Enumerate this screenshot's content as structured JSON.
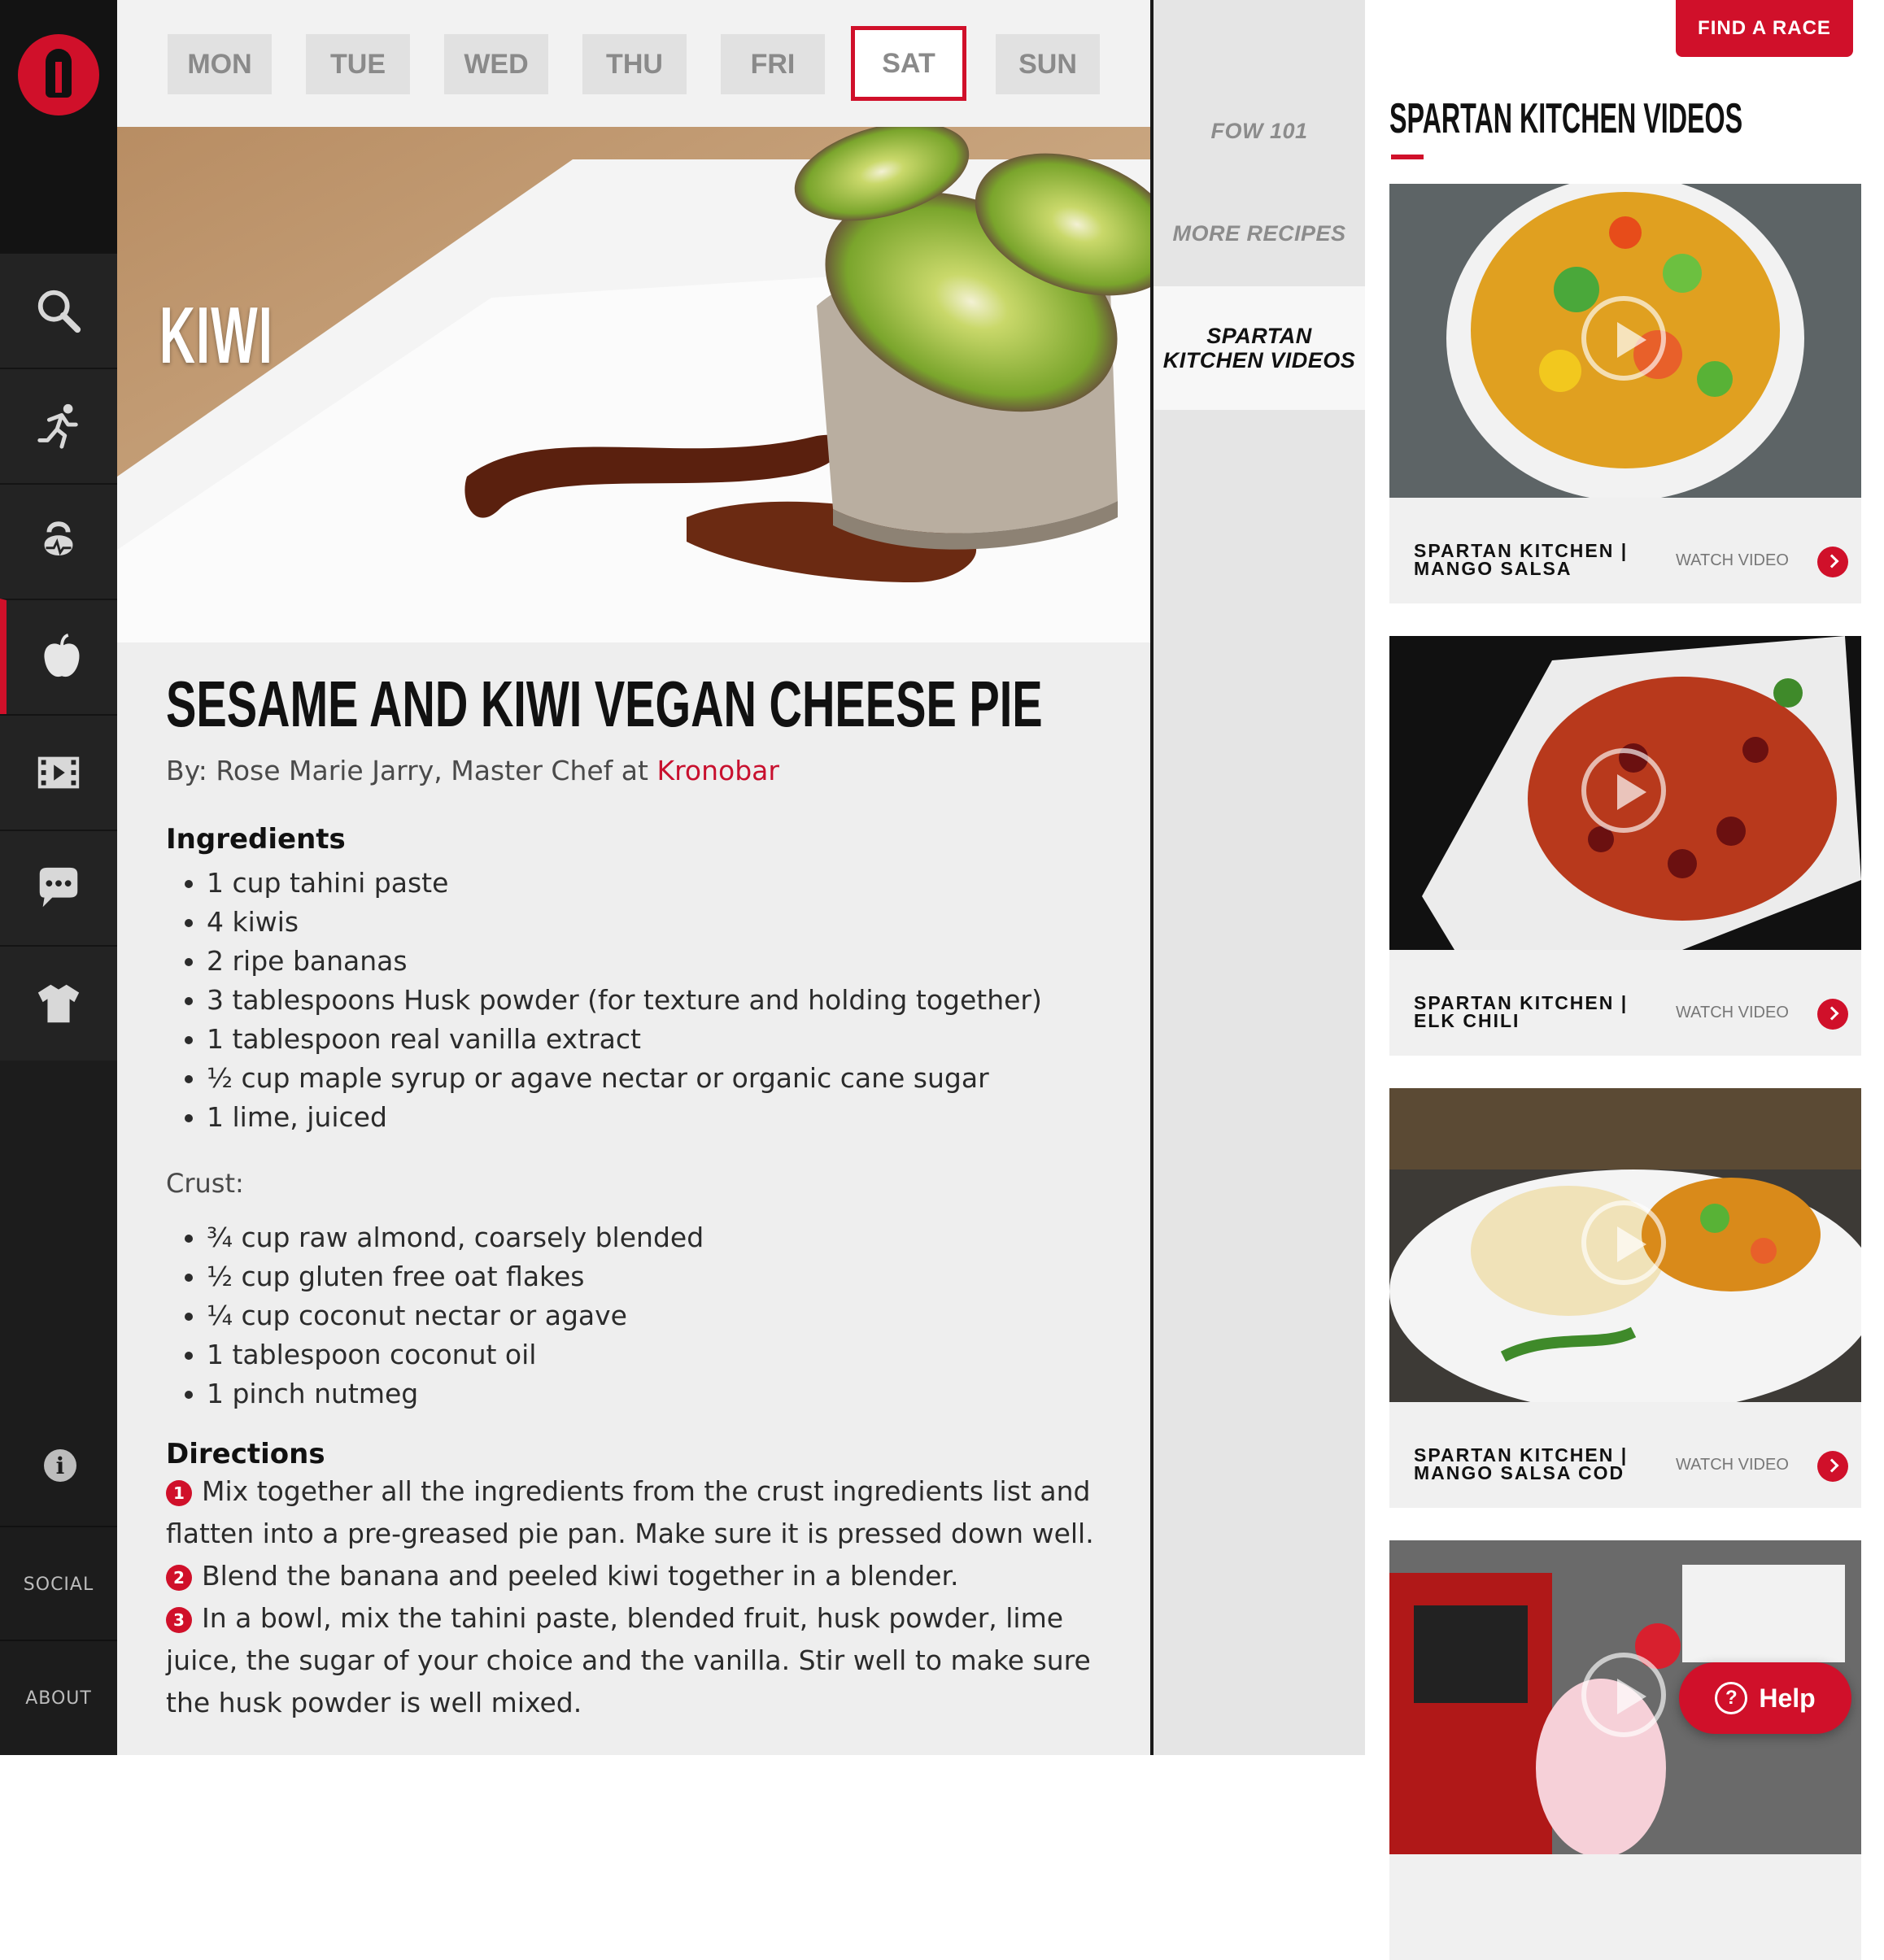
{
  "sidebar": {
    "items": [
      {
        "name": "search",
        "icon": "search-icon"
      },
      {
        "name": "run",
        "icon": "runner-icon"
      },
      {
        "name": "training",
        "icon": "kettlebell-icon"
      },
      {
        "name": "nutrition",
        "icon": "apple-icon",
        "active": true
      },
      {
        "name": "video",
        "icon": "film-icon"
      },
      {
        "name": "chat",
        "icon": "chat-icon"
      },
      {
        "name": "gear",
        "icon": "shirt-icon"
      }
    ],
    "info_icon": "info-icon",
    "social_label": "SOCIAL",
    "about_label": "ABOUT"
  },
  "days": {
    "tabs": [
      "MON",
      "TUE",
      "WED",
      "THU",
      "FRI",
      "SAT",
      "SUN"
    ],
    "selected": "SAT"
  },
  "hero": {
    "title": "KIWI"
  },
  "recipe": {
    "title": "SESAME AND KIWI VEGAN CHEESE PIE",
    "byline_prefix": "By: Rose Marie Jarry, Master Chef at ",
    "byline_link": "Kronobar",
    "ingredients_heading": "Ingredients",
    "ingredients": [
      "1 cup tahini paste",
      "4 kiwis",
      "2 ripe bananas",
      "3 tablespoons Husk powder (for texture and holding together)",
      "1 tablespoon real vanilla extract",
      "½ cup maple syrup or agave nectar or organic cane sugar",
      "1 lime, juiced"
    ],
    "crust_label": "Crust:",
    "crust": [
      "¾ cup raw almond, coarsely blended",
      "½ cup gluten free oat flakes",
      "¼ cup coconut nectar or agave",
      "1 tablespoon coconut oil",
      "1 pinch nutmeg"
    ],
    "directions_heading": "Directions",
    "directions": [
      {
        "num": "1",
        "text": "Mix together all the ingredients from the crust ingredients list and flatten into a pre-greased pie pan. Make sure it is pressed down well."
      },
      {
        "num": "2",
        "text": "Blend the banana and peeled kiwi together in a blender."
      },
      {
        "num": "3",
        "text": "In a bowl, mix the tahini paste, blended fruit, husk powder, lime juice, the sugar of your choice and the vanilla. Stir well to make sure the husk powder is well mixed."
      }
    ]
  },
  "subnav": {
    "items": [
      "FOW 101",
      "MORE RECIPES"
    ],
    "active_line1": "SPARTAN",
    "active_line2": "KITCHEN VIDEOS"
  },
  "right": {
    "find_race": "FIND A RACE",
    "heading": "SPARTAN KITCHEN VIDEOS",
    "watch_label": "WATCH VIDEO",
    "videos": [
      {
        "line1": "SPARTAN KITCHEN |",
        "line2": "MANGO SALSA"
      },
      {
        "line1": "SPARTAN KITCHEN |",
        "line2": "ELK CHILI"
      },
      {
        "line1": "SPARTAN KITCHEN |",
        "line2": "MANGO SALSA COD"
      },
      {
        "line1": "",
        "line2": ""
      }
    ],
    "help_label": "Help"
  },
  "colors": {
    "accent": "#d0102a",
    "sidebar": "#1c1c1c",
    "content_bg": "#eeeeee"
  }
}
